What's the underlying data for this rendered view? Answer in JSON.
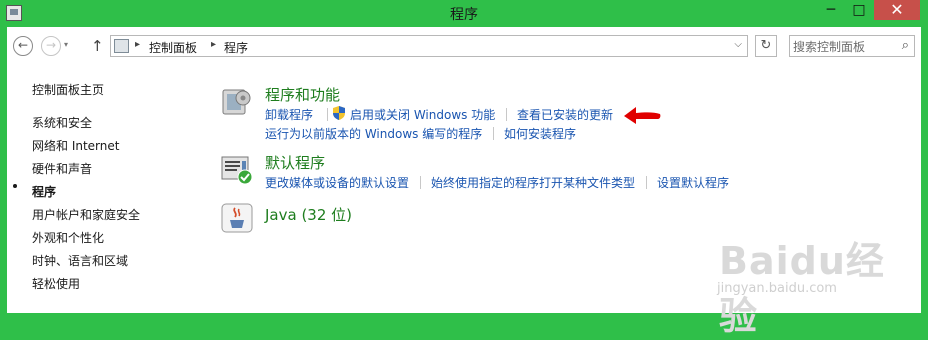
{
  "window": {
    "title": "程序",
    "minimize_glyph": "─",
    "maximize_glyph": "□",
    "close_glyph": "✕"
  },
  "toolbar": {
    "back_glyph": "←",
    "forward_glyph": "→",
    "history_glyph": "▾",
    "up_glyph": "↑",
    "address_sep_glyph": "▸",
    "address_dropdown_glyph": "⌵",
    "refresh_glyph": "↻",
    "breadcrumb": [
      "控制面板",
      "程序"
    ],
    "search_placeholder": "搜索控制面板",
    "search_glyph": "⌕"
  },
  "sidebar": {
    "items": [
      {
        "label": "控制面板主页"
      },
      {
        "label": "系统和安全"
      },
      {
        "label": "网络和 Internet"
      },
      {
        "label": "硬件和声音"
      },
      {
        "label": "程序",
        "current": true
      },
      {
        "label": "用户帐户和家庭安全"
      },
      {
        "label": "外观和个性化"
      },
      {
        "label": "时钟、语言和区域"
      },
      {
        "label": "轻松使用"
      }
    ]
  },
  "categories": [
    {
      "title": "程序和功能",
      "icon": "programs-features-icon",
      "links": [
        "卸载程序",
        "启用或关闭 Windows 功能",
        "查看已安装的更新",
        "运行为以前版本的 Windows 编写的程序",
        "如何安装程序"
      ]
    },
    {
      "title": "默认程序",
      "icon": "default-programs-icon",
      "links": [
        "更改媒体或设备的默认设置",
        "始终使用指定的程序打开某种文件类型",
        "设置默认程序"
      ]
    },
    {
      "title": "Java (32 位)",
      "icon": "java-icon",
      "links": []
    }
  ],
  "watermark": {
    "text": "Baidu经验",
    "sub": "jingyan.baidu.com"
  },
  "colors": {
    "frame": "#2fbf49",
    "link": "#1a55b0",
    "category_title": "#1e7d1e",
    "close_button": "#c7504a",
    "annotation_arrow": "#e00000"
  }
}
